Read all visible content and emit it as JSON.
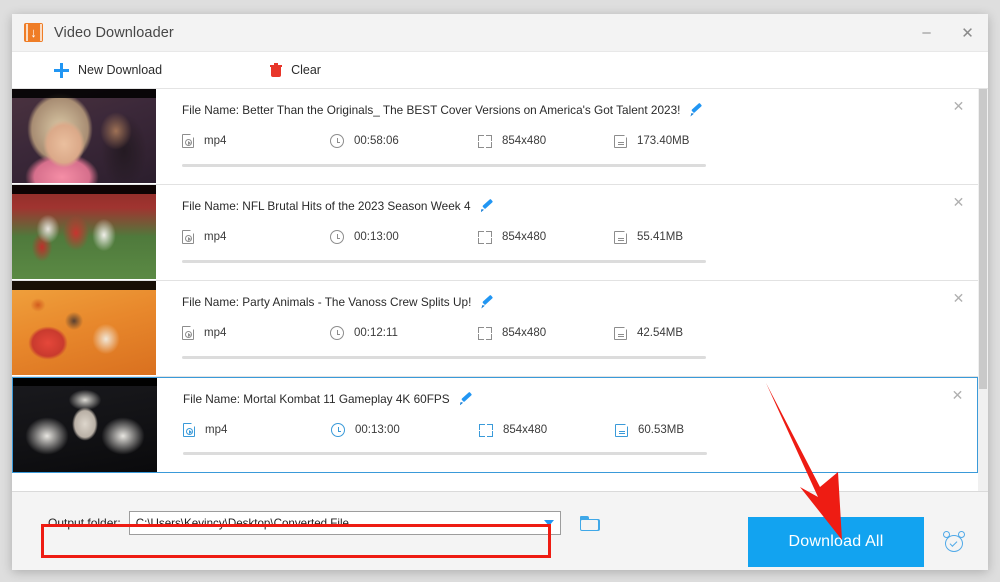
{
  "window": {
    "title": "Video Downloader",
    "app_icon": "video-download-icon",
    "minimize_label": "–",
    "close_label": "✕"
  },
  "toolbar": {
    "new_download_label": "New Download",
    "new_download_icon": "plus-icon",
    "clear_label": "Clear",
    "clear_icon": "trash-icon"
  },
  "list": {
    "file_name_prefix": "File Name: ",
    "close_glyph": "✕",
    "items": [
      {
        "file_name": "File Name: Better Than the Originals_ The BEST Cover Versions on America's Got Talent 2023!",
        "format": "mp4",
        "duration": "00:58:06",
        "resolution": "854x480",
        "size": "173.40MB",
        "selected": false,
        "thumbnail": "america-got-talent-thumbnail"
      },
      {
        "file_name": "File Name: NFL Brutal Hits of the 2023 Season Week 4",
        "format": "mp4",
        "duration": "00:13:00",
        "resolution": "854x480",
        "size": "55.41MB",
        "selected": false,
        "thumbnail": "nfl-football-thumbnail"
      },
      {
        "file_name": "File Name: Party Animals - The Vanoss Crew Splits Up!",
        "format": "mp4",
        "duration": "00:12:11",
        "resolution": "854x480",
        "size": "42.54MB",
        "selected": false,
        "thumbnail": "party-animals-thumbnail"
      },
      {
        "file_name": "File Name: Mortal Kombat 11 Gameplay 4K 60FPS",
        "format": "mp4",
        "duration": "00:13:00",
        "resolution": "854x480",
        "size": "60.53MB",
        "selected": true,
        "thumbnail": "mortal-kombat-thumbnail"
      }
    ]
  },
  "bottom": {
    "output_folder_label": "Output folder:",
    "output_folder_value": "C:\\Users\\Kevincy\\Desktop\\Converted File",
    "browse_icon": "folder-icon",
    "download_all_label": "Download All",
    "schedule_icon": "alarm-clock-icon"
  },
  "annotation": {
    "arrow_color": "#ee1c13",
    "highlight_color": "#ee1c13"
  },
  "colors": {
    "accent_blue": "#12a3f0",
    "selected_border": "#3a9ad9",
    "app_orange": "#ef7d26",
    "clear_red": "#e8362a"
  }
}
